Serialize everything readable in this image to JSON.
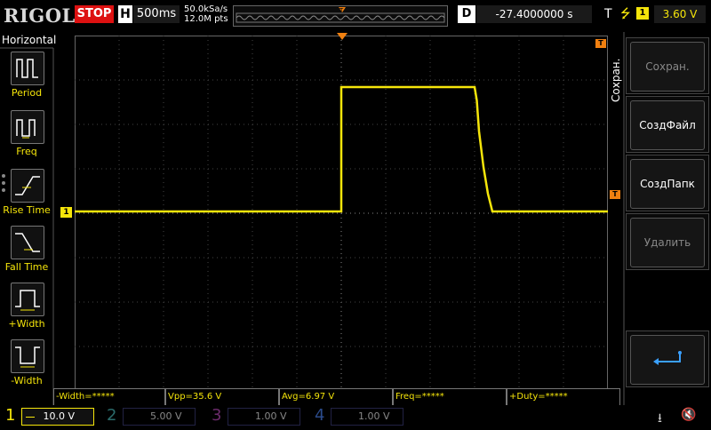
{
  "topbar": {
    "logo": "RIGOL",
    "run_state": "STOP",
    "horizontal_label": "H",
    "timebase": "500ms",
    "sample_rate": "50.0kSa/s",
    "memory_depth": "12.0M pts",
    "delay_label": "D",
    "delay_value": "-27.4000000 s",
    "trigger_label": "T",
    "trigger_slope_icon": "rising-edge",
    "trigger_channel": "1",
    "trigger_level": "3.60 V"
  },
  "left_panel": {
    "title": "Horizontal",
    "items": [
      {
        "label": "Period",
        "icon": "period-icon"
      },
      {
        "label": "Freq",
        "icon": "freq-icon"
      },
      {
        "label": "Rise Time",
        "icon": "rise-time-icon"
      },
      {
        "label": "Fall Time",
        "icon": "fall-time-icon"
      },
      {
        "label": "+Width",
        "icon": "pos-width-icon"
      },
      {
        "label": "-Width",
        "icon": "neg-width-icon"
      }
    ]
  },
  "right_panel": {
    "title": "Сохран.",
    "buttons": [
      {
        "label": "Сохран.",
        "enabled": false
      },
      {
        "label": "СоздФайл",
        "enabled": true
      },
      {
        "label": "СоздПапк",
        "enabled": true
      },
      {
        "label": "Удалить",
        "enabled": false
      }
    ],
    "back_icon": "return-arrow-icon"
  },
  "markers": {
    "trigger_position_marker": "T",
    "channel1_marker": "1",
    "trigger_level_marker": "T"
  },
  "measurements": [
    "-Width=*****",
    "Vpp=35.6 V",
    "Avg=6.97 V",
    "Freq=*****",
    "+Duty=*****"
  ],
  "channels": [
    {
      "num": "1",
      "scale": "10.0 V",
      "color": "#f5e50a",
      "active": true
    },
    {
      "num": "2",
      "scale": "5.00 V",
      "color": "#00c0c0",
      "active": false
    },
    {
      "num": "3",
      "scale": "1.00 V",
      "color": "#e020e0",
      "active": false
    },
    {
      "num": "4",
      "scale": "1.00 V",
      "color": "#2080ff",
      "active": false
    }
  ],
  "status_icons": [
    "usb-icon",
    "speaker-muted-icon"
  ],
  "colors": {
    "channel1": "#f5e50a",
    "stop": "#dd1111",
    "trigger_marker": "#f08010",
    "grid": "#555555"
  },
  "chart_data": {
    "type": "line",
    "series": [
      {
        "x_div": [
          0,
          6.0,
          6.0,
          9.0,
          9.05,
          9.1,
          9.2,
          9.3,
          9.35,
          9.4,
          12
        ],
        "y_div": [
          0,
          0,
          2.8,
          2.8,
          2.5,
          1.8,
          1.0,
          0.4,
          0.2,
          0,
          0
        ]
      }
    ]
  }
}
